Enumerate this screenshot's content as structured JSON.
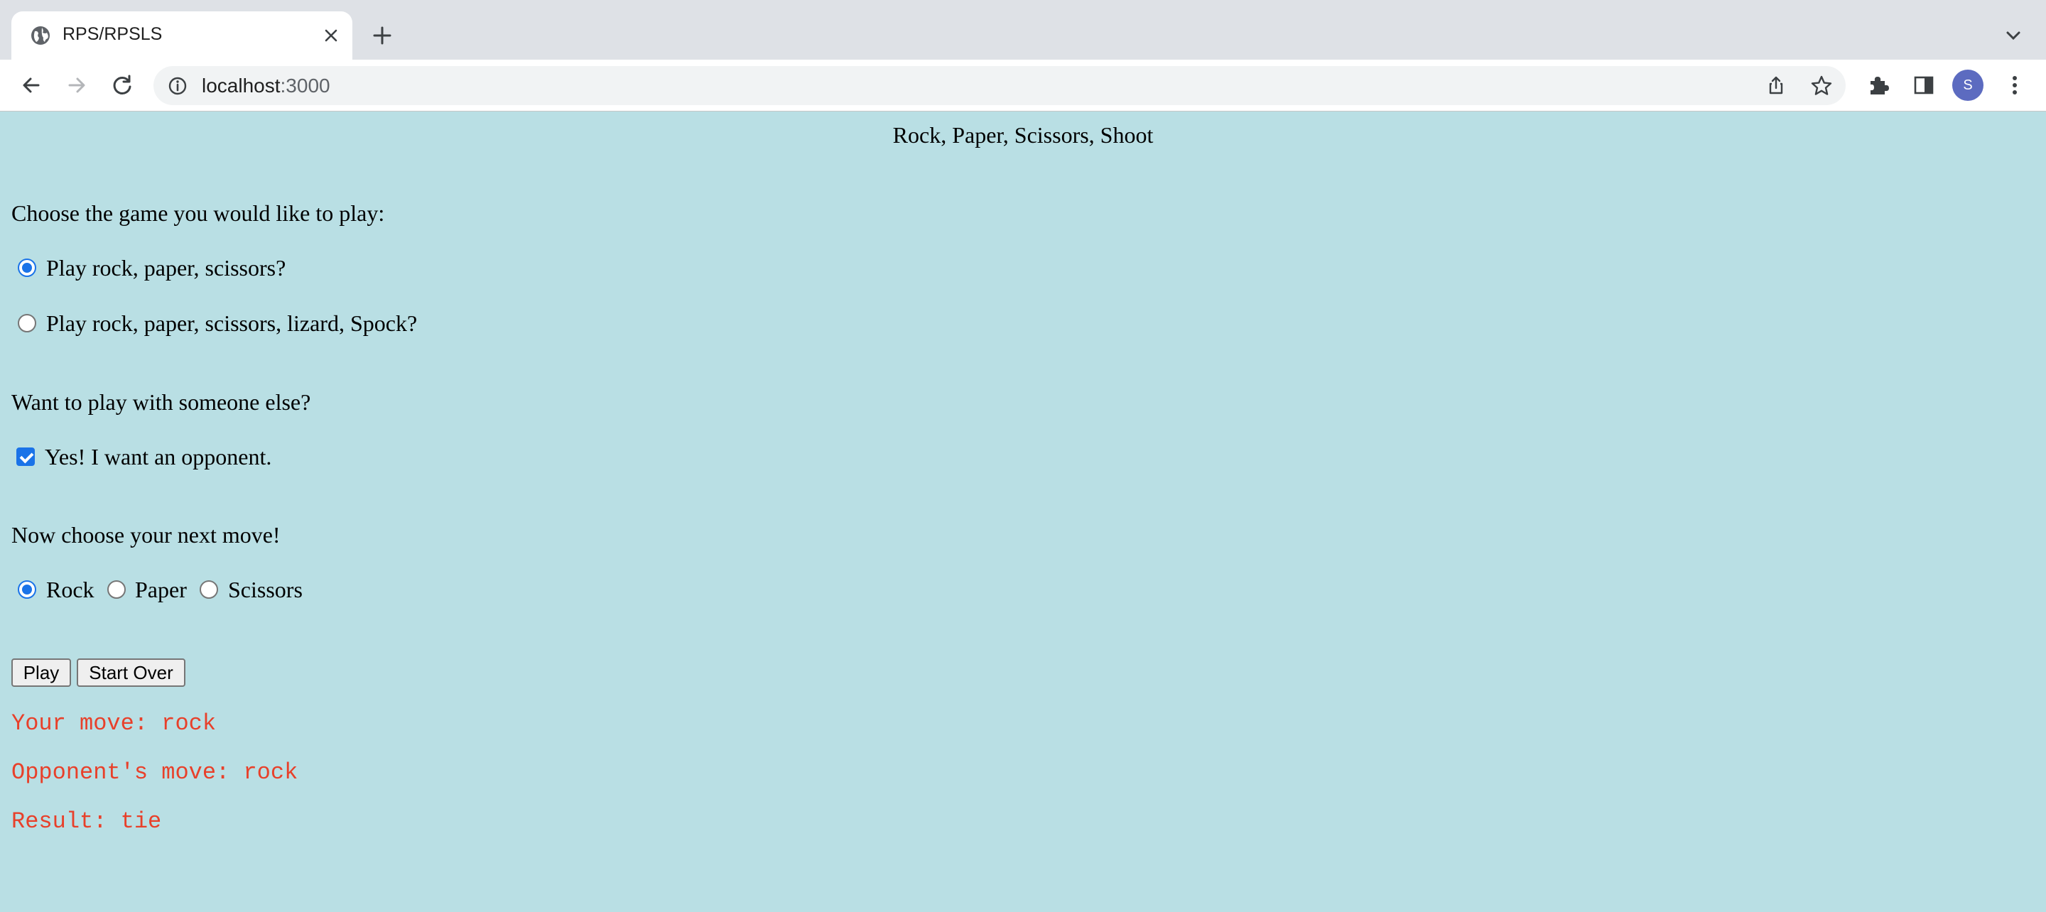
{
  "browser": {
    "tab_title": "RPS/RPSLS",
    "url_host": "localhost",
    "url_port": ":3000",
    "profile_initial": "S",
    "accent_color": "#1a73e8",
    "avatar_color": "#5c6bc0"
  },
  "page": {
    "title": "Rock, Paper, Scissors, Shoot",
    "background_color": "#b9dfe4",
    "game_prompt": "Choose the game you would like to play:",
    "game_options": [
      {
        "label": "Play rock, paper, scissors?",
        "checked": true
      },
      {
        "label": "Play rock, paper, scissors, lizard, Spock?",
        "checked": false
      }
    ],
    "opponent_prompt": "Want to play with someone else?",
    "opponent_checkbox": {
      "label": "Yes! I want an opponent.",
      "checked": true
    },
    "move_prompt": "Now choose your next move!",
    "moves": [
      {
        "label": "Rock",
        "checked": true
      },
      {
        "label": "Paper",
        "checked": false
      },
      {
        "label": "Scissors",
        "checked": false
      }
    ],
    "buttons": {
      "play": "Play",
      "start_over": "Start Over"
    },
    "results": {
      "your_move": "Your move: rock",
      "opponent_move": "Opponent's move: rock",
      "result": "Result: tie",
      "color": "#e8402a"
    }
  }
}
